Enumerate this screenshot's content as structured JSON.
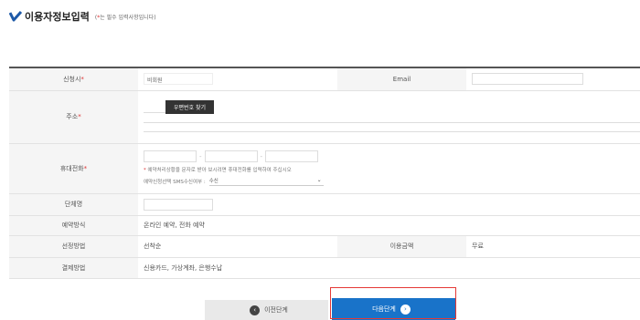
{
  "header": {
    "title": "이용자정보입력",
    "note_star": "*",
    "note_text": "는 필수 입력사항입니다",
    "note_open": "(",
    "note_close": ")"
  },
  "form": {
    "applicant": {
      "label": "신청시",
      "req": "*",
      "value": "비회원"
    },
    "email": {
      "label": "Email",
      "value": ""
    },
    "address": {
      "label": "주소",
      "req": "*",
      "zip_button": "우편번호 찾기"
    },
    "phone": {
      "label": "휴대전화",
      "req": "*",
      "dash": "-",
      "note_star": "*",
      "note": "예약처리상황을 문자로 받아 보시려면 휴대전화를 입력하여 주십시오",
      "sms_label": "예약신청선택 SMS수신여부 :",
      "sms_value": "수신"
    },
    "group": {
      "label": "단체명",
      "value": ""
    },
    "reservation_method": {
      "label": "예약방식",
      "value": "온라인 예약, 전화 예약"
    },
    "selection_method": {
      "label": "선정방법",
      "value": "선착순"
    },
    "usage_fee": {
      "label": "이용금액",
      "value": "무료"
    },
    "payment_method": {
      "label": "결제방법",
      "value": "신용카드, 가상계좌, 은행수납"
    }
  },
  "buttons": {
    "prev": "이전단계",
    "next": "다음단계"
  },
  "icons": {
    "logo": "check-logo-icon",
    "prev": "left-arrow-circle-icon",
    "next": "right-arrow-circle-icon"
  },
  "colors": {
    "accent_blue": "#1973c9",
    "required_red": "#d33",
    "highlight": "#e53935"
  }
}
